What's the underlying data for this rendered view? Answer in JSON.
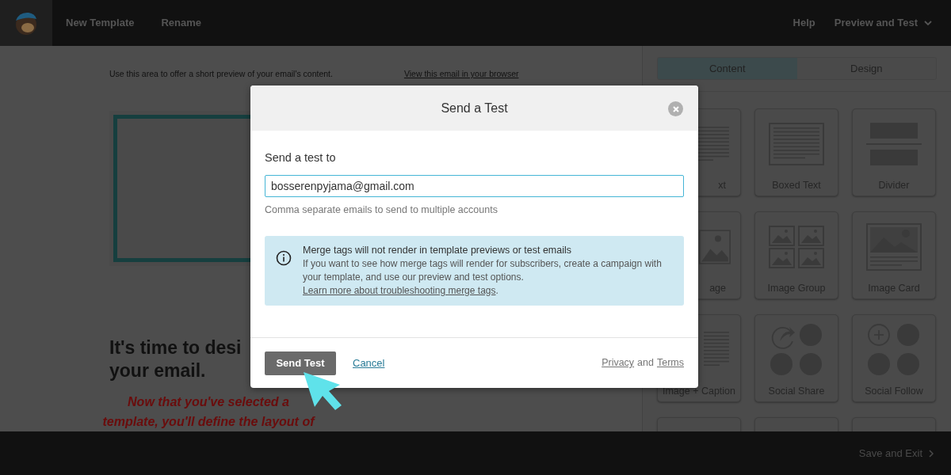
{
  "top_bar": {
    "menu": [
      "New Template",
      "Rename"
    ],
    "right": [
      {
        "label": "Help",
        "dropdown": false
      },
      {
        "label": "Preview and Test",
        "dropdown": true
      }
    ]
  },
  "editor": {
    "preheader": "Use this area to offer a short preview of your email's content.",
    "preheader_link": "View this email in your browser",
    "heading_lines": [
      "It's time to desi",
      "your email."
    ],
    "intro_lines": [
      "Now that you've selected a",
      "template, you'll define the layout of"
    ]
  },
  "panel": {
    "tabs": [
      {
        "label": "Content",
        "selected": true
      },
      {
        "label": "Design",
        "selected": false
      }
    ],
    "blocks": [
      {
        "kind": "text",
        "label": "xt"
      },
      {
        "kind": "boxed_text",
        "label": "Boxed Text"
      },
      {
        "kind": "divider",
        "label": "Divider"
      },
      {
        "kind": "image",
        "label": "age"
      },
      {
        "kind": "image_group",
        "label": "Image Group"
      },
      {
        "kind": "image_card",
        "label": "Image Card"
      },
      {
        "kind": "image_caption",
        "label": "Image + Caption"
      },
      {
        "kind": "social_share",
        "label": "Social Share"
      },
      {
        "kind": "social_follow",
        "label": "Social Follow"
      },
      {
        "kind": "cut"
      },
      {
        "kind": "cut"
      },
      {
        "kind": "cut"
      }
    ]
  },
  "modal": {
    "title": "Send a Test",
    "field_label": "Send a test to",
    "email": "bosserenpyjama@gmail.com",
    "hint": "Comma separate emails to send to multiple accounts",
    "notice": {
      "title": "Merge tags will not render in template previews or test emails",
      "body": "If you want to see how merge tags will render for subscribers, create a campaign with your template, and use our preview and test options.",
      "link": "Learn more about troubleshooting merge tags",
      "after_link": "."
    },
    "send": "Send Test",
    "cancel": "Cancel",
    "privacy": "Privacy",
    "and": "and",
    "terms": "Terms"
  },
  "bottom_bar": {
    "save": "Save and Exit"
  }
}
